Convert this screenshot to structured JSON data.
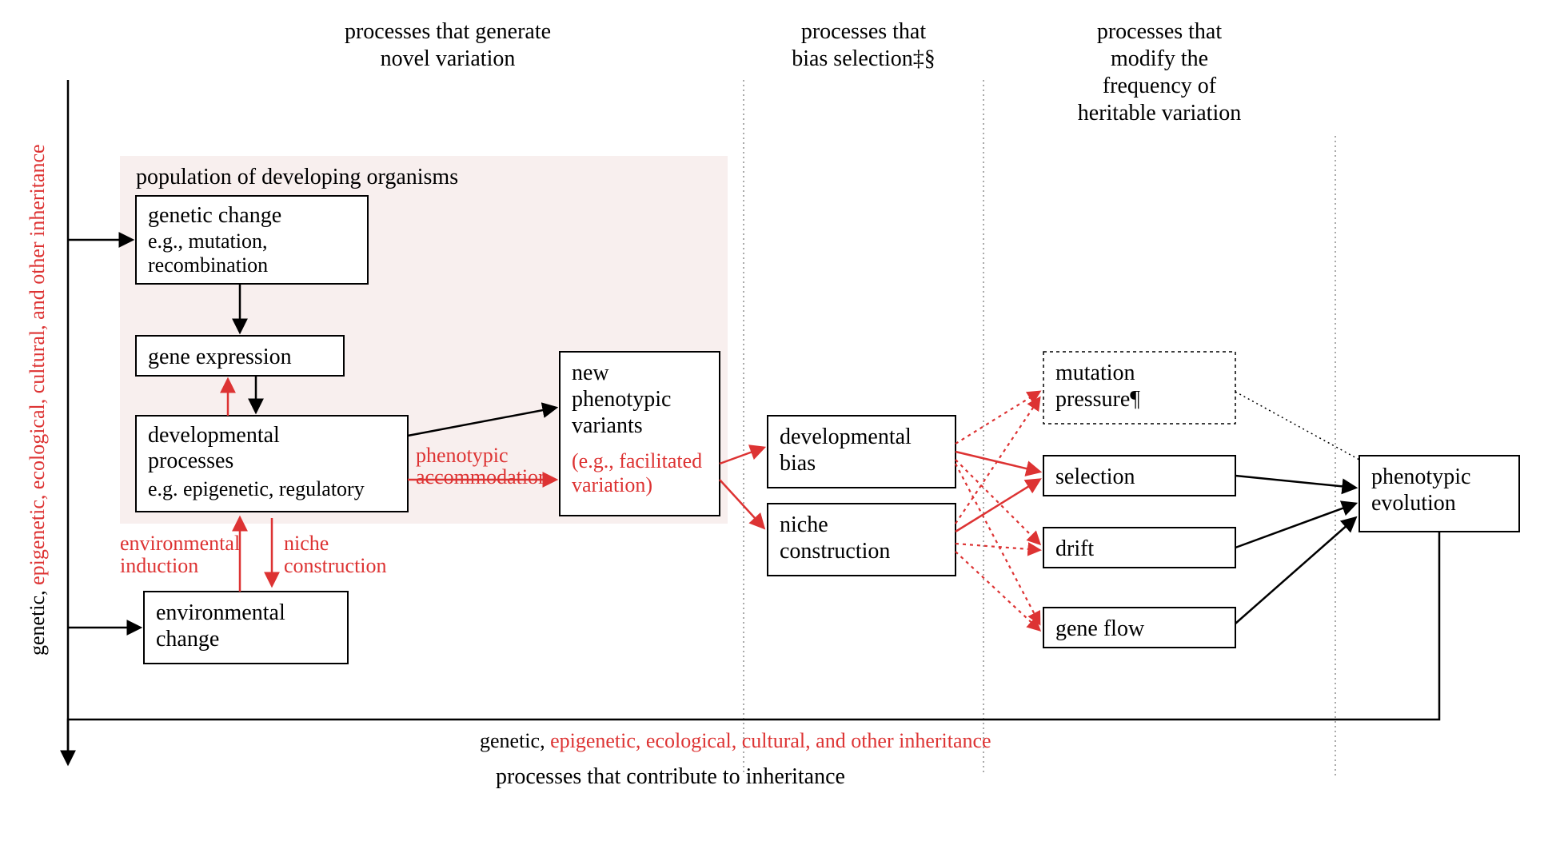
{
  "headers": {
    "col1a": "processes that generate",
    "col1b": "novel variation",
    "col2a": "processes that",
    "col2b": "bias selection‡§",
    "col3a": "processes that",
    "col3b": "modify the",
    "col3c": "frequency of",
    "col3d": "heritable variation"
  },
  "population_title": "population of developing organisms",
  "boxes": {
    "genetic_change_t": "genetic change",
    "genetic_change_s1": "e.g., mutation,",
    "genetic_change_s2": "recombination",
    "gene_expression": "gene expression",
    "dev_proc_t": "developmental",
    "dev_proc_t2": "processes",
    "dev_proc_s": "e.g. epigenetic, regulatory",
    "env_change_t1": "environmental",
    "env_change_t2": "change",
    "new_var_t1": "new",
    "new_var_t2": "phenotypic",
    "new_var_t3": "variants",
    "new_var_s1": "(e.g., facilitated",
    "new_var_s2": "variation)",
    "dev_bias_t1": "developmental",
    "dev_bias_t2": "bias",
    "niche_t1": "niche",
    "niche_t2": "construction",
    "mutpress_t1": "mutation",
    "mutpress_t2": "pressure¶",
    "selection": "selection",
    "drift": "drift",
    "geneflow": "gene flow",
    "pheno_t1": "phenotypic",
    "pheno_t2": "evolution"
  },
  "labels": {
    "phen_accom1": "phenotypic",
    "phen_accom2": "accommodation",
    "env_induct1": "environmental",
    "env_induct2": "induction",
    "niche_con1": "niche",
    "niche_con2": "construction"
  },
  "bottom": {
    "inh_black": "genetic,",
    "inh_red": " epigenetic, ecological, cultural, and other inheritance",
    "caption": "processes that contribute to inheritance"
  },
  "left": {
    "black": "genetic,",
    "red": " epigenetic, ecological, cultural, and other inheritance"
  }
}
